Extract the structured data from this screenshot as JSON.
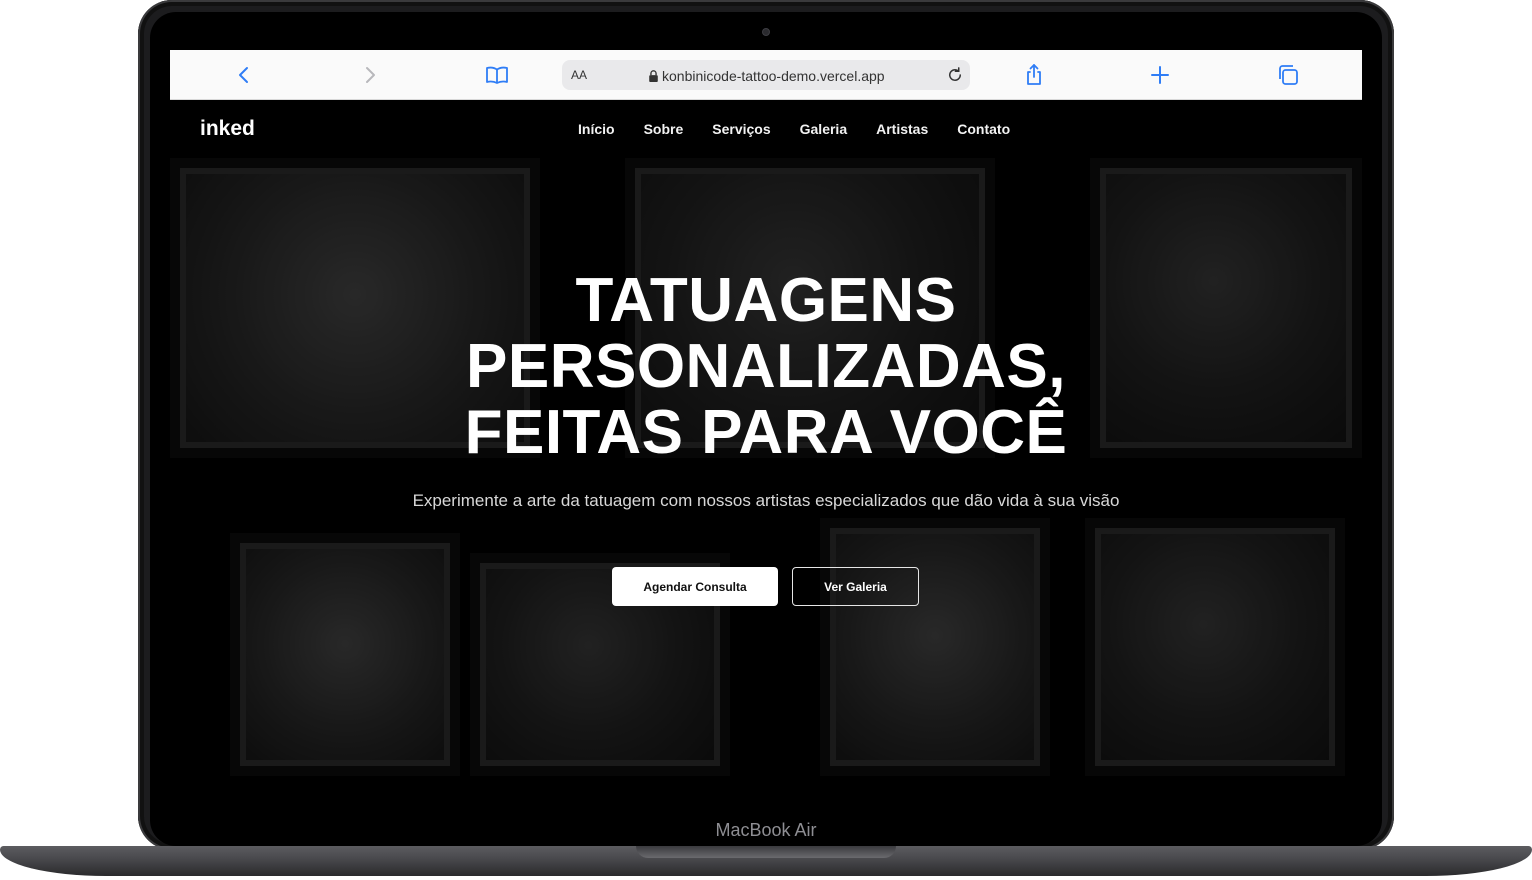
{
  "device": {
    "model_label": "MacBook Air"
  },
  "browser": {
    "address_aa": "AA",
    "url": "konbinicode-tattoo-demo.vercel.app",
    "icons": [
      "back-icon",
      "forward-icon",
      "bookmarks-icon",
      "lock-icon",
      "reload-icon",
      "share-icon",
      "new-tab-icon",
      "tabs-icon"
    ]
  },
  "site": {
    "logo": "inked",
    "nav": [
      {
        "label": "Início"
      },
      {
        "label": "Sobre"
      },
      {
        "label": "Serviços"
      },
      {
        "label": "Galeria"
      },
      {
        "label": "Artistas"
      },
      {
        "label": "Contato"
      }
    ],
    "hero": {
      "title": "TATUAGENS PERSONALIZADAS, FEITAS PARA VOCÊ",
      "subtitle": "Experimente a arte da tatuagem com nossos artistas especializados que dão vida à sua visão",
      "primary_button": "Agendar Consulta",
      "secondary_button": "Ver Galeria"
    }
  },
  "colors": {
    "accent": "#2f7df6",
    "site_bg": "#000000",
    "text": "#ffffff"
  }
}
